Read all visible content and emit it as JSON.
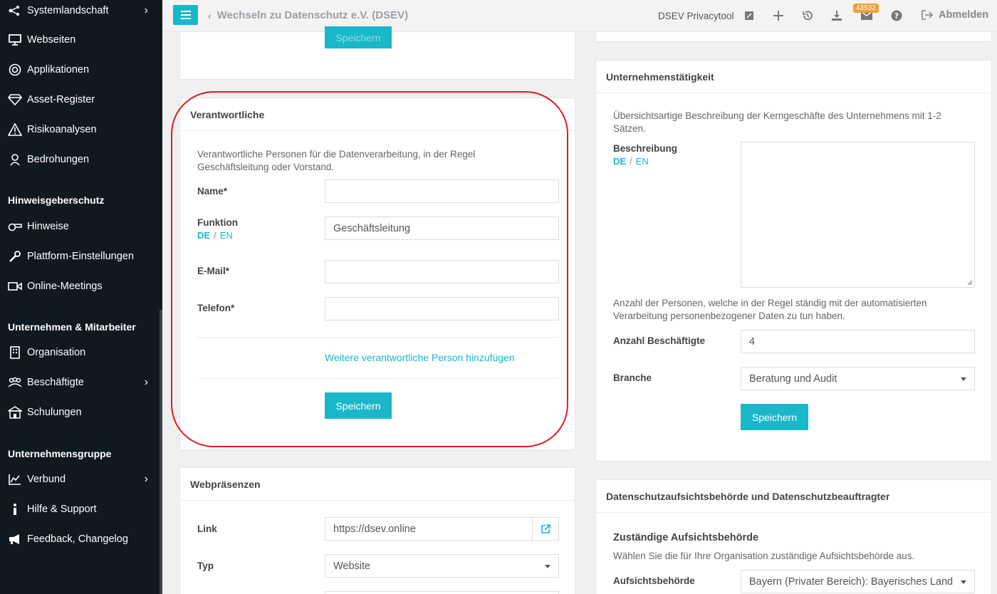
{
  "sidebar": {
    "items": [
      {
        "label": "Systemlandschaft",
        "icon": "network-icon",
        "chevron": "›"
      },
      {
        "label": "Webseiten",
        "icon": "monitor-icon"
      },
      {
        "label": "Applikationen",
        "icon": "target-icon"
      },
      {
        "label": "Asset-Register",
        "icon": "diamond-icon"
      },
      {
        "label": "Risikoanalysen",
        "icon": "warning-icon"
      },
      {
        "label": "Bedrohungen",
        "icon": "bug-icon"
      },
      {
        "label": "Hinweise",
        "icon": "whistle-icon"
      },
      {
        "label": "Plattform-Einstellungen",
        "icon": "wrench-icon"
      },
      {
        "label": "Online-Meetings",
        "icon": "video-icon"
      },
      {
        "label": "Organisation",
        "icon": "building-icon"
      },
      {
        "label": "Beschäftigte",
        "icon": "users-icon",
        "chevron": "›"
      },
      {
        "label": "Schulungen",
        "icon": "school-icon"
      },
      {
        "label": "Verbund",
        "icon": "chart-icon",
        "chevron": "›"
      },
      {
        "label": "Hilfe & Support",
        "icon": "info-icon"
      },
      {
        "label": "Feedback, Changelog",
        "icon": "megaphone-icon"
      }
    ],
    "sections": [
      "Hinweisgeberschutz",
      "Unternehmen & Mitarbeiter",
      "Unternehmensgruppe"
    ]
  },
  "topbar": {
    "breadcrumb": "Wechseln zu Datenschutz e.V. (DSEV)",
    "tool_name": "DSEV Privacytool",
    "badge": "43532",
    "logout": "Abmelden"
  },
  "top_panel": {
    "button": "Speichern"
  },
  "verantwortliche": {
    "title": "Verantwortliche",
    "description": "Verantwortliche Personen für die Datenverarbeitung, in der Regel Geschäftsleitung oder Vorstand.",
    "name_label": "Name*",
    "name_value": "",
    "funktion_label": "Funktion",
    "funktion_value": "Geschäftsleitung",
    "email_label": "E-Mail*",
    "email_value": "",
    "telefon_label": "Telefon*",
    "telefon_value": "",
    "add_link": "Weitere verantwortliche Person hinzufügen",
    "save": "Speichern"
  },
  "lang": {
    "de": "DE",
    "sep": "/",
    "en": "EN"
  },
  "webpraesenzen": {
    "title": "Webpräsenzen",
    "link_label": "Link",
    "link_value": "https://dsev.online",
    "typ_label": "Typ",
    "typ_value": "Website"
  },
  "taetigkeit": {
    "title": "Unternehmenstätigkeit",
    "description": "Übersichtsartige Beschreibung der Kerngeschäfte des Unternehmens mit 1-2 Sätzen.",
    "beschreibung_label": "Beschreibung",
    "count_description": "Anzahl der Personen, welche in der Regel ständig mit der automatisierten Verarbeitung personenbezogener Daten zu tun haben.",
    "anzahl_label": "Anzahl Beschäftigte",
    "anzahl_value": "4",
    "branche_label": "Branche",
    "branche_value": "Beratung und Audit",
    "save": "Speichern"
  },
  "aufsicht": {
    "title": "Datenschutzaufsichtsbehörde und Datenschutzbeauftragter",
    "subtitle": "Zuständige Aufsichtsbehörde",
    "description": "Wählen Sie die für Ihre Organisation zuständige Aufsichtsbehörde aus.",
    "label": "Aufsichtsbehörde",
    "value": "Bayern (Privater Bereich): Bayerisches Land"
  }
}
